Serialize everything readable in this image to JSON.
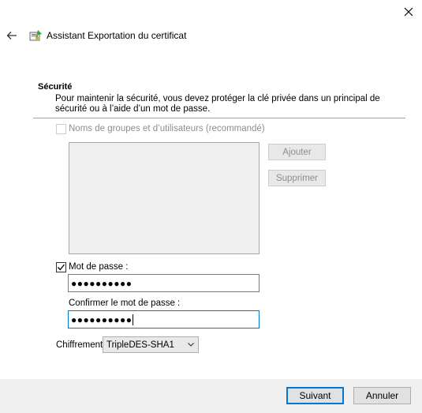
{
  "window": {
    "title": "Assistant Exportation du certificat"
  },
  "security": {
    "title": "Sécurité",
    "description": "Pour maintenir la sécurité, vous devez protéger la clé privée dans un principal de sécurité ou à l’aide d’un mot de passe."
  },
  "groups": {
    "checkbox_label": "Noms de groupes et d’utilisateurs (recommandé)",
    "checked": false,
    "enabled": false,
    "add_label": "Ajouter",
    "remove_label": "Supprimer"
  },
  "password": {
    "checkbox_label": "Mot de passe :",
    "checked": true,
    "value_masked": "●●●●●●●●●●",
    "confirm_label": "Confirmer le mot de passe :",
    "confirm_value_masked": "●●●●●●●●●●"
  },
  "encryption": {
    "label": "Chiffrement",
    "selected": "TripleDES-SHA1"
  },
  "footer": {
    "next_label": "Suivant",
    "cancel_label": "Annuler"
  },
  "icons": {
    "close": "close-icon",
    "back": "back-arrow-icon",
    "wizard": "certificate-wizard-icon",
    "check": "checkmark-icon",
    "dropdown": "chevron-down-icon"
  },
  "colors": {
    "accent": "#0078d7",
    "disabled_text": "#8d8d8d",
    "footer_bg": "#f0f0f0"
  }
}
